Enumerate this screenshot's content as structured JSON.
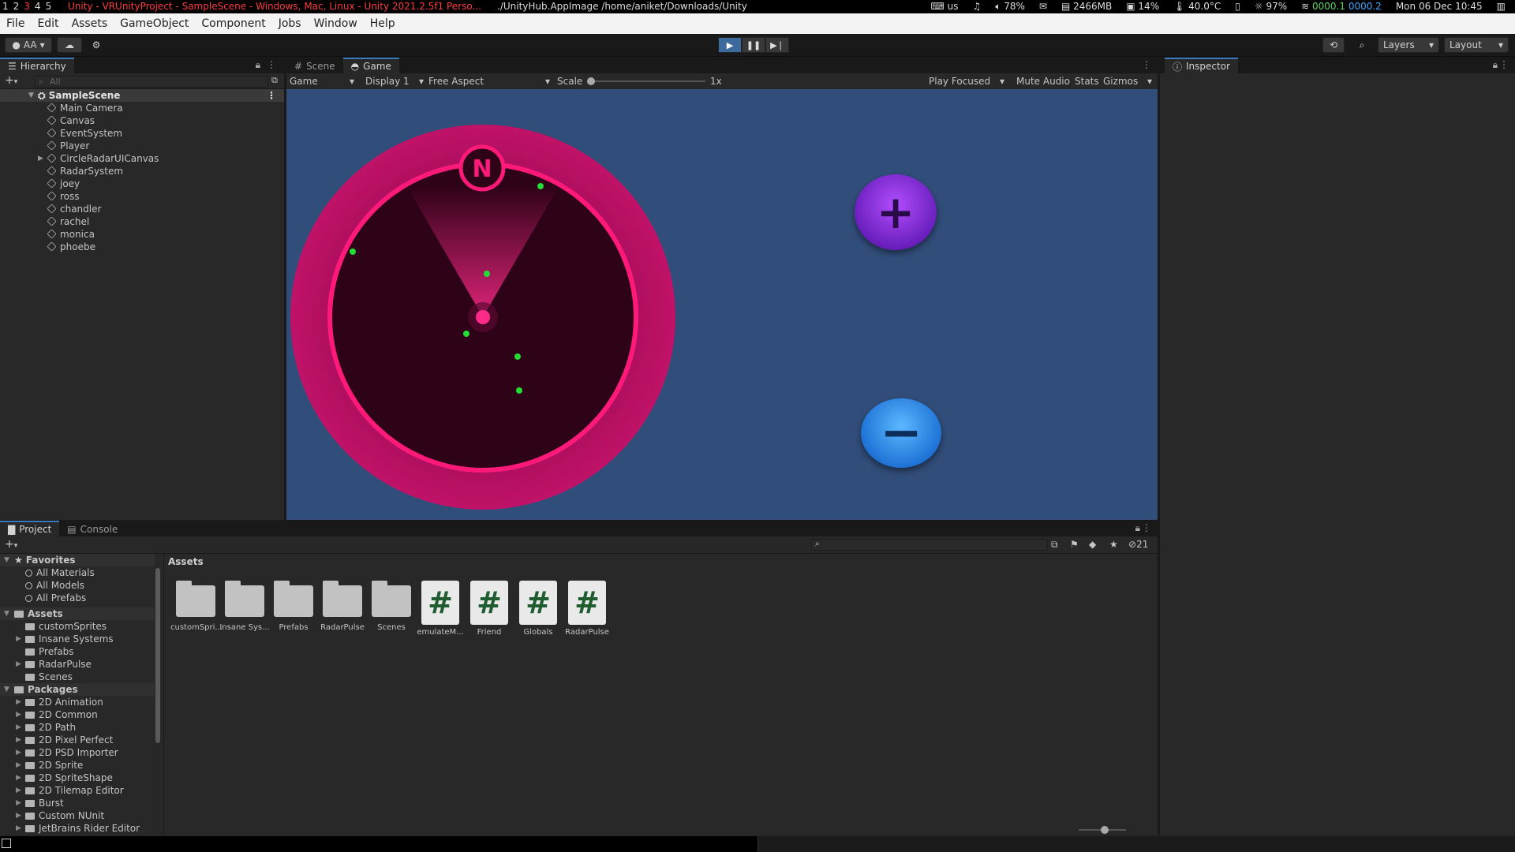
{
  "statusbar": {
    "workspaces": [
      "1",
      "2",
      "3",
      "4",
      "5"
    ],
    "active_workspace": "3",
    "window_title": "Unity - VRUnityProject - SampleScene - Windows, Mac, Linux - Unity 2021.2.5f1 Perso...",
    "window_path": "./UnityHub.AppImage /home/aniket/Downloads/Unity",
    "keyboard": "us",
    "volume": "78%",
    "memory": "2466MB",
    "cpu": "14%",
    "temperature": "40.0°C",
    "brightness": "97%",
    "net_up": "0000.1",
    "net_down": "0000.2",
    "datetime": "Mon 06 Dec 10:45"
  },
  "menubar": [
    "File",
    "Edit",
    "Assets",
    "GameObject",
    "Component",
    "Jobs",
    "Window",
    "Help"
  ],
  "toolbar": {
    "account_label": "AA",
    "layers_label": "Layers",
    "layout_label": "Layout"
  },
  "hierarchy": {
    "tab_label": "Hierarchy",
    "search_placeholder": "All",
    "scene_name": "SampleScene",
    "items": [
      {
        "label": "Main Camera",
        "has_children": false
      },
      {
        "label": "Canvas",
        "has_children": false
      },
      {
        "label": "EventSystem",
        "has_children": false
      },
      {
        "label": "Player",
        "has_children": false
      },
      {
        "label": "CircleRadarUICanvas",
        "has_children": true
      },
      {
        "label": "RadarSystem",
        "has_children": false
      },
      {
        "label": "joey",
        "has_children": false
      },
      {
        "label": "ross",
        "has_children": false
      },
      {
        "label": "chandler",
        "has_children": false
      },
      {
        "label": "rachel",
        "has_children": false
      },
      {
        "label": "monica",
        "has_children": false
      },
      {
        "label": "phoebe",
        "has_children": false
      }
    ]
  },
  "game": {
    "tabs": {
      "scene": "Scene",
      "game": "Game"
    },
    "view_mode": "Game",
    "display": "Display 1",
    "aspect": "Free Aspect",
    "scale_label": "Scale",
    "scale_value": "1x",
    "play_mode": "Play Focused",
    "mute_audio": "Mute Audio",
    "stats": "Stats",
    "gizmos": "Gizmos",
    "background_color": "#314d79",
    "radar": {
      "north_label": "N",
      "ring_color": "#ff1a7a",
      "blip_color": "#22dd33"
    },
    "zoom_in_label": "+",
    "zoom_out_label": "−"
  },
  "inspector": {
    "tab_label": "Inspector"
  },
  "project": {
    "tabs": {
      "project": "Project",
      "console": "Console"
    },
    "hidden_count": "21",
    "breadcrumb": "Assets",
    "favorites": {
      "header": "Favorites",
      "items": [
        "All Materials",
        "All Models",
        "All Prefabs"
      ]
    },
    "assets_tree": {
      "header": "Assets",
      "items": [
        {
          "label": "customSprites",
          "has_children": false
        },
        {
          "label": "Insane Systems",
          "has_children": true
        },
        {
          "label": "Prefabs",
          "has_children": false
        },
        {
          "label": "RadarPulse",
          "has_children": true
        },
        {
          "label": "Scenes",
          "has_children": false
        }
      ]
    },
    "packages_tree": {
      "header": "Packages",
      "items": [
        "2D Animation",
        "2D Common",
        "2D Path",
        "2D Pixel Perfect",
        "2D PSD Importer",
        "2D Sprite",
        "2D SpriteShape",
        "2D Tilemap Editor",
        "Burst",
        "Custom NUnit",
        "JetBrains Rider Editor"
      ]
    },
    "assets": [
      {
        "label": "customSpri...",
        "kind": "folder"
      },
      {
        "label": "Insane Sys...",
        "kind": "folder"
      },
      {
        "label": "Prefabs",
        "kind": "folder"
      },
      {
        "label": "RadarPulse",
        "kind": "folder"
      },
      {
        "label": "Scenes",
        "kind": "folder"
      },
      {
        "label": "emulateM...",
        "kind": "script"
      },
      {
        "label": "Friend",
        "kind": "script"
      },
      {
        "label": "Globals",
        "kind": "script"
      },
      {
        "label": "RadarPulse",
        "kind": "script"
      }
    ]
  }
}
